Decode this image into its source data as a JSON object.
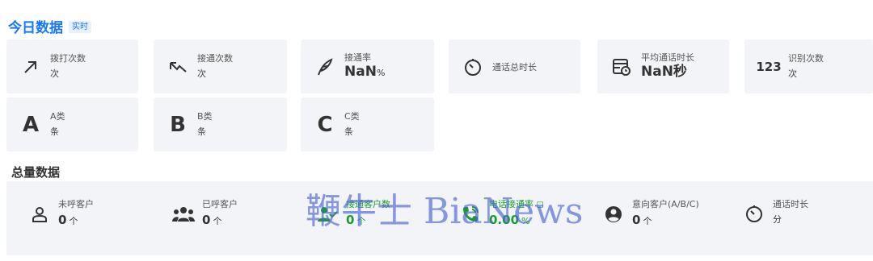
{
  "today": {
    "title": "今日数据",
    "badge": "实时",
    "cards_row1": [
      {
        "label": "拨打次数",
        "value": "次",
        "icon": "arrow-up-right-icon"
      },
      {
        "label": "接通次数",
        "value": "次",
        "icon": "arrow-down-right-check-icon"
      },
      {
        "label": "接通率",
        "value": "NaN",
        "unit": "%",
        "icon": "feather-icon"
      },
      {
        "label": "通话总时长",
        "icon": "timer-icon"
      },
      {
        "label": "平均通话时长",
        "value": "NaN秒",
        "icon": "calendar-clock-icon"
      },
      {
        "label": "识别次数",
        "value": "次",
        "icon": "numbers-123-icon",
        "icon_text": "123"
      }
    ],
    "cards_row2": [
      {
        "letter": "A",
        "label": "A类",
        "value": "条"
      },
      {
        "letter": "B",
        "label": "B类",
        "value": "条"
      },
      {
        "letter": "C",
        "label": "C类",
        "value": "条"
      }
    ]
  },
  "total": {
    "title": "总量数据",
    "stats": [
      {
        "label": "未呼客户",
        "value": "0",
        "unit": "个",
        "icon": "user-outline-icon"
      },
      {
        "label": "已呼客户",
        "value": "0",
        "unit": "个",
        "icon": "users-icon"
      },
      {
        "label": "接通客户数",
        "value": "0",
        "unit": "个",
        "icon": "user-check-icon"
      },
      {
        "label": "电话接通率 ◻",
        "value": "0.00",
        "unit": "%",
        "icon": "phone-call-icon"
      },
      {
        "label": "意向客户(A/B/C)",
        "value": "0",
        "unit": "个",
        "icon": "account-circle-icon"
      },
      {
        "label": "通话时长",
        "value": "分",
        "icon": "timer-icon"
      }
    ]
  },
  "watermark": "鞭牛士 BiaNews",
  "colors": {
    "accent": "#1677ff",
    "green": "#1a9c2e",
    "card_bg": "#f3f4f7"
  }
}
